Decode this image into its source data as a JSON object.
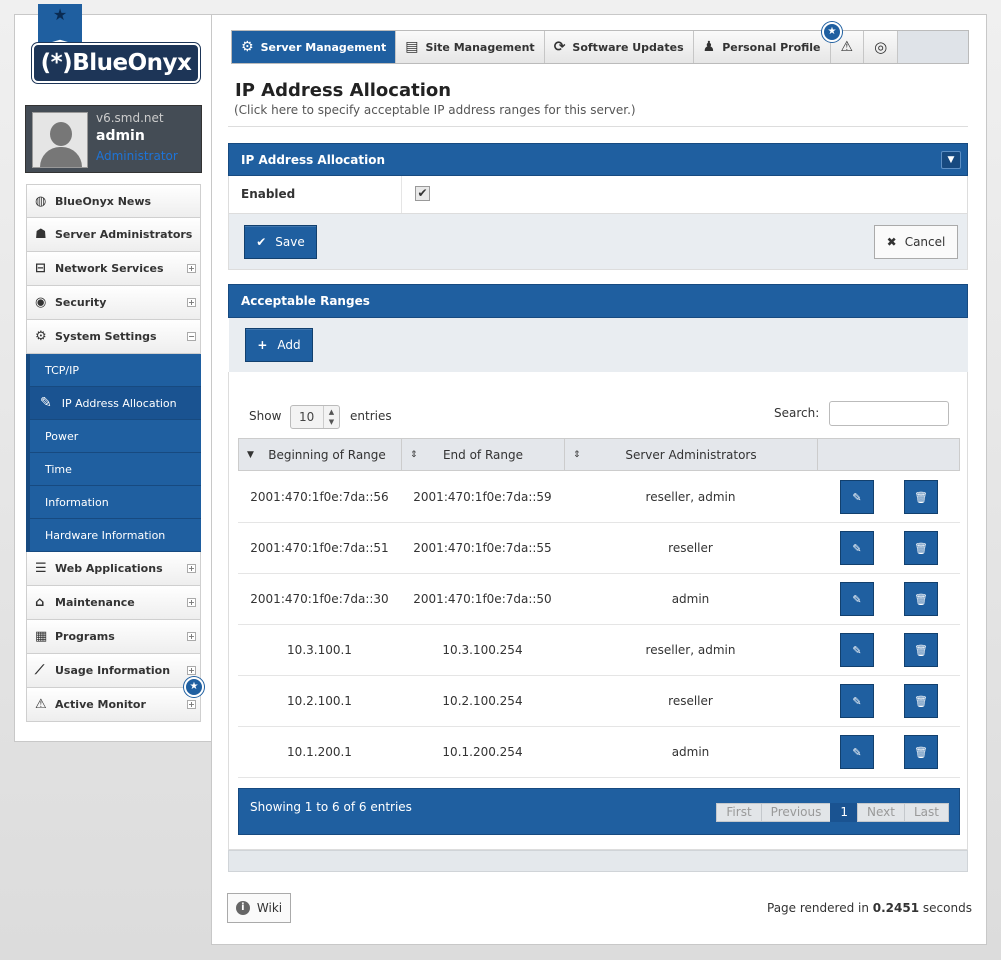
{
  "user": {
    "host": "v6.smd.net",
    "name": "admin",
    "role": "Administrator"
  },
  "logo": {
    "text": "(*)BlueOnyx"
  },
  "sidebar": {
    "items": [
      {
        "label": "BlueOnyx News",
        "icon": "globe-icon"
      },
      {
        "label": "Server Administrators",
        "icon": "users-icon"
      },
      {
        "label": "Network Services",
        "icon": "network-icon"
      },
      {
        "label": "Security",
        "icon": "eye-icon"
      },
      {
        "label": "System Settings",
        "icon": "gear-icon"
      },
      {
        "label": "Web Applications",
        "icon": "server-icon"
      },
      {
        "label": "Maintenance",
        "icon": "lock-icon"
      },
      {
        "label": "Programs",
        "icon": "chip-icon"
      },
      {
        "label": "Usage Information",
        "icon": "chart-icon"
      },
      {
        "label": "Active Monitor",
        "icon": "warning-icon"
      }
    ],
    "sub": [
      "TCP/IP",
      "IP Address Allocation",
      "Power",
      "Time",
      "Information",
      "Hardware Information"
    ]
  },
  "topnav": {
    "tabs": [
      {
        "label": "Server Management",
        "icon": "gear-icon"
      },
      {
        "label": "Site Management",
        "icon": "sites-icon"
      },
      {
        "label": "Software Updates",
        "icon": "refresh-icon"
      },
      {
        "label": "Personal Profile",
        "icon": "user-icon"
      }
    ]
  },
  "page": {
    "title": "IP Address Allocation",
    "subtitle": "(Click here to specify acceptable IP address ranges for this server.)"
  },
  "panel1": {
    "title": "IP Address Allocation",
    "enabled_label": "Enabled",
    "enabled": true,
    "save": "Save",
    "cancel": "Cancel"
  },
  "panel2": {
    "title": "Acceptable Ranges",
    "add": "Add",
    "show": "Show",
    "length": "10",
    "entries": "entries",
    "search": "Search:",
    "columns": [
      "Beginning of Range",
      "End of Range",
      "Server Administrators"
    ],
    "rows": [
      [
        "2001:470:1f0e:7da::56",
        "2001:470:1f0e:7da::59",
        "reseller, admin"
      ],
      [
        "2001:470:1f0e:7da::51",
        "2001:470:1f0e:7da::55",
        "reseller"
      ],
      [
        "2001:470:1f0e:7da::30",
        "2001:470:1f0e:7da::50",
        "admin"
      ],
      [
        "10.3.100.1",
        "10.3.100.254",
        "reseller, admin"
      ],
      [
        "10.2.100.1",
        "10.2.100.254",
        "reseller"
      ],
      [
        "10.1.200.1",
        "10.1.200.254",
        "admin"
      ]
    ],
    "info": "Showing 1 to 6 of 6 entries",
    "pager": [
      "First",
      "Previous",
      "1",
      "Next",
      "Last"
    ]
  },
  "footer": {
    "wiki": "Wiki",
    "render_prefix": "Page rendered in ",
    "render_time": "0.2451",
    "render_suffix": " seconds"
  }
}
